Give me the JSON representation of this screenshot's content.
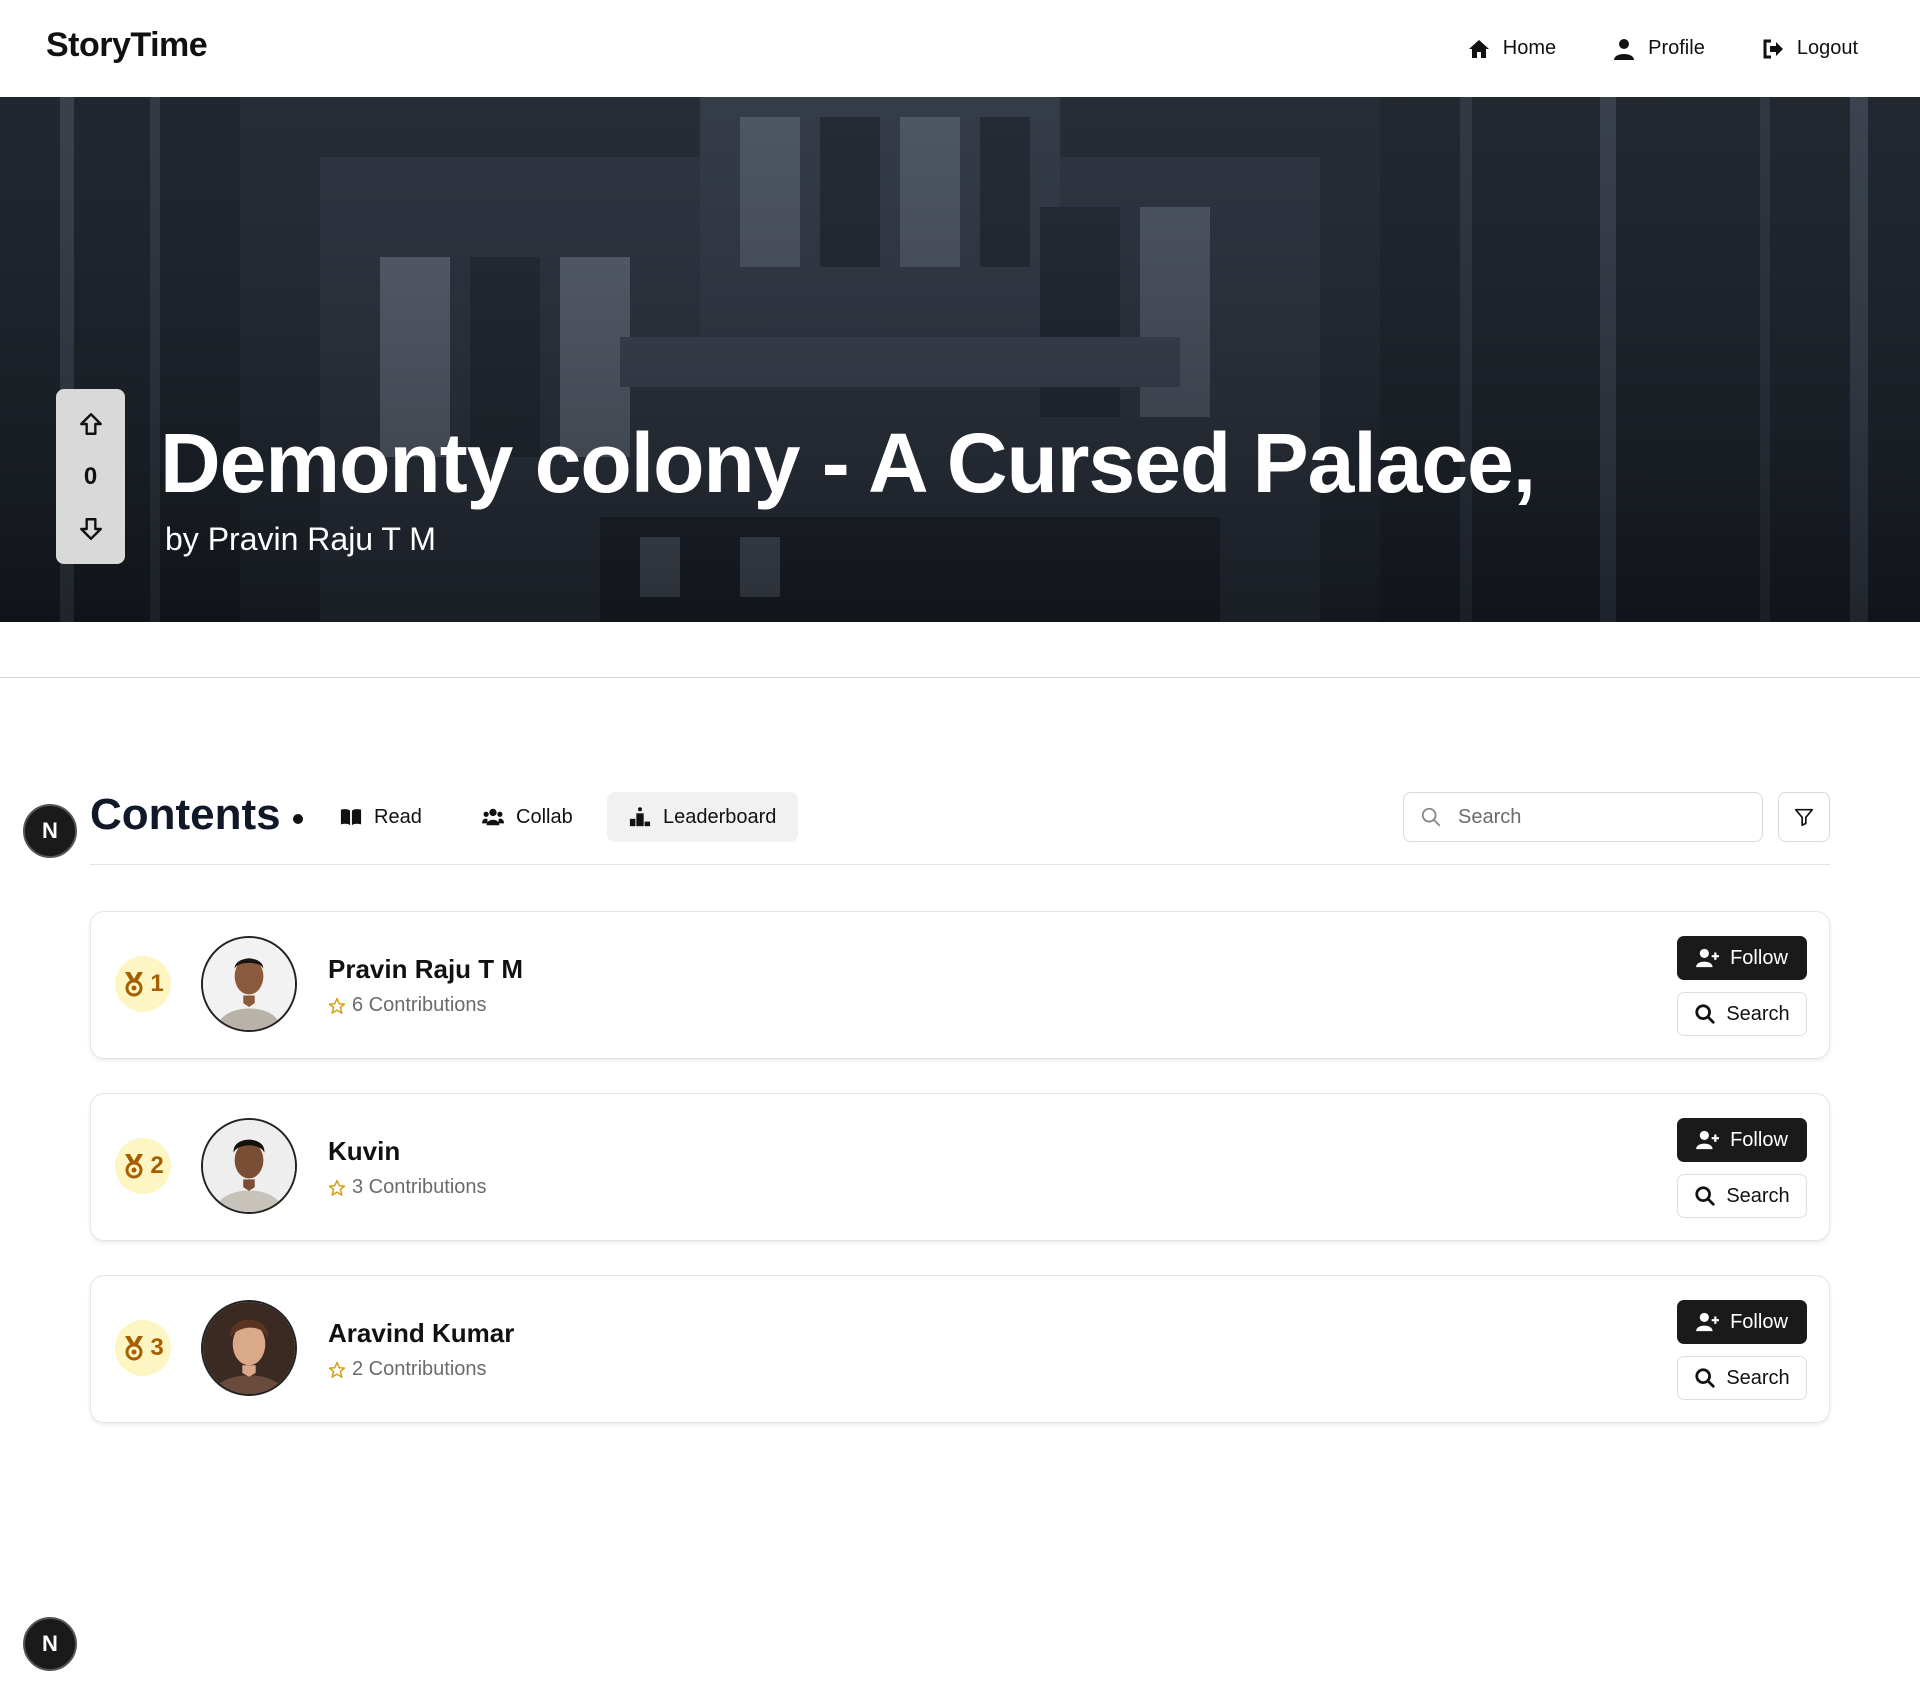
{
  "brand": "StoryTime",
  "nav": {
    "home": "Home",
    "profile": "Profile",
    "logout": "Logout"
  },
  "story": {
    "title": "Demonty colony - A Cursed Palace,",
    "author": "by Pravin Raju T M",
    "votes": "0"
  },
  "next_badge": "N",
  "toolbar": {
    "title": "Contents",
    "tabs": [
      {
        "label": "Read",
        "icon": "book-open-icon"
      },
      {
        "label": "Collab",
        "icon": "users-icon"
      },
      {
        "label": "Leaderboard",
        "icon": "podium-icon",
        "active": true
      }
    ],
    "search_placeholder": "Search"
  },
  "leaderboard": [
    {
      "rank": "1",
      "name": "Pravin Raju T M",
      "contributions": "6 Contributions",
      "follow": "Follow",
      "search": "Search"
    },
    {
      "rank": "2",
      "name": "Kuvin",
      "contributions": "3 Contributions",
      "follow": "Follow",
      "search": "Search"
    },
    {
      "rank": "3",
      "name": "Aravind Kumar",
      "contributions": "2 Contributions",
      "follow": "Follow",
      "search": "Search"
    }
  ],
  "colors": {
    "rank_badge_bg": "#fdf6c3",
    "rank_text": "#a65f00",
    "star": "#d4a017",
    "primary_button": "#1a1a1a"
  }
}
